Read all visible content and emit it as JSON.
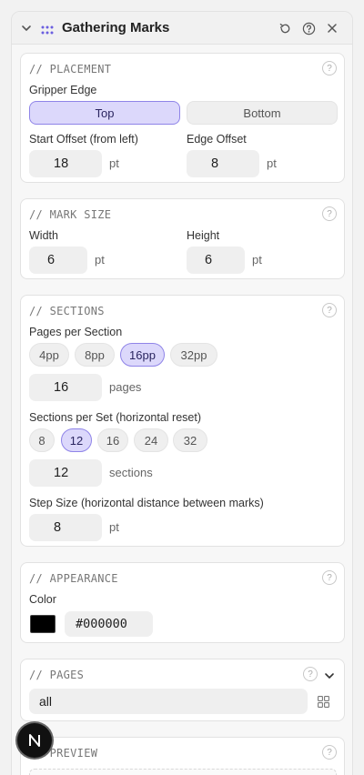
{
  "header": {
    "title": "Gathering Marks"
  },
  "placement": {
    "title": "// PLACEMENT",
    "gripper_label": "Gripper Edge",
    "options": [
      "Top",
      "Bottom"
    ],
    "selected": "Top",
    "start_offset_label": "Start Offset (from left)",
    "start_offset_value": "18",
    "start_offset_unit": "pt",
    "edge_offset_label": "Edge Offset",
    "edge_offset_value": "8",
    "edge_offset_unit": "pt"
  },
  "mark_size": {
    "title": "// MARK SIZE",
    "width_label": "Width",
    "width_value": "6",
    "width_unit": "pt",
    "height_label": "Height",
    "height_value": "6",
    "height_unit": "pt"
  },
  "sections": {
    "title": "// SECTIONS",
    "pages_label": "Pages per Section",
    "pages_options": [
      "4pp",
      "8pp",
      "16pp",
      "32pp"
    ],
    "pages_selected": "16pp",
    "pages_value": "16",
    "pages_unit": "pages",
    "set_label": "Sections per Set (horizontal reset)",
    "set_options": [
      "8",
      "12",
      "16",
      "24",
      "32"
    ],
    "set_selected": "12",
    "set_value": "12",
    "set_unit": "sections",
    "step_label": "Step Size (horizontal distance between marks)",
    "step_value": "8",
    "step_unit": "pt"
  },
  "appearance": {
    "title": "// APPEARANCE",
    "color_label": "Color",
    "color_hex": "#000000"
  },
  "pages": {
    "title": "// PAGES",
    "value": "all"
  },
  "preview": {
    "title": "// PREVIEW"
  },
  "avatar": {
    "letter": "N"
  },
  "colors": {
    "accent": "#8f84e8",
    "accent_bg": "#dcd8fb",
    "mark_color": "#000000"
  }
}
